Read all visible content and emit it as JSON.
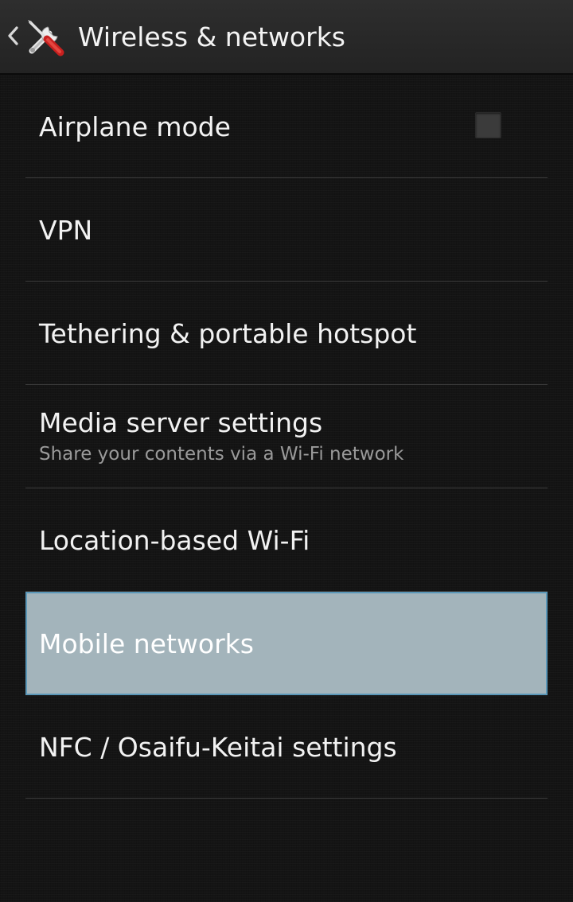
{
  "action_bar": {
    "title": "Wireless & networks",
    "up_icon": "chevron-left-icon",
    "app_icon": "tools-icon"
  },
  "items": [
    {
      "label": "Airplane mode",
      "control": "checkbox",
      "checked": false
    },
    {
      "label": "VPN"
    },
    {
      "label": "Tethering & portable hotspot"
    },
    {
      "label": "Media server settings",
      "summary": "Share your contents via a Wi-Fi network"
    },
    {
      "label": "Location-based Wi-Fi"
    },
    {
      "label": "Mobile networks",
      "selected": true
    },
    {
      "label": "NFC / Osaifu-Keitai settings"
    }
  ],
  "colors": {
    "background": "#141414",
    "action_bar": "#2a2a2a",
    "selected_row": "#a3b4bb",
    "selected_border": "#5a97b8",
    "divider": "#3a3a3a",
    "summary_text": "#9a9a9a"
  }
}
